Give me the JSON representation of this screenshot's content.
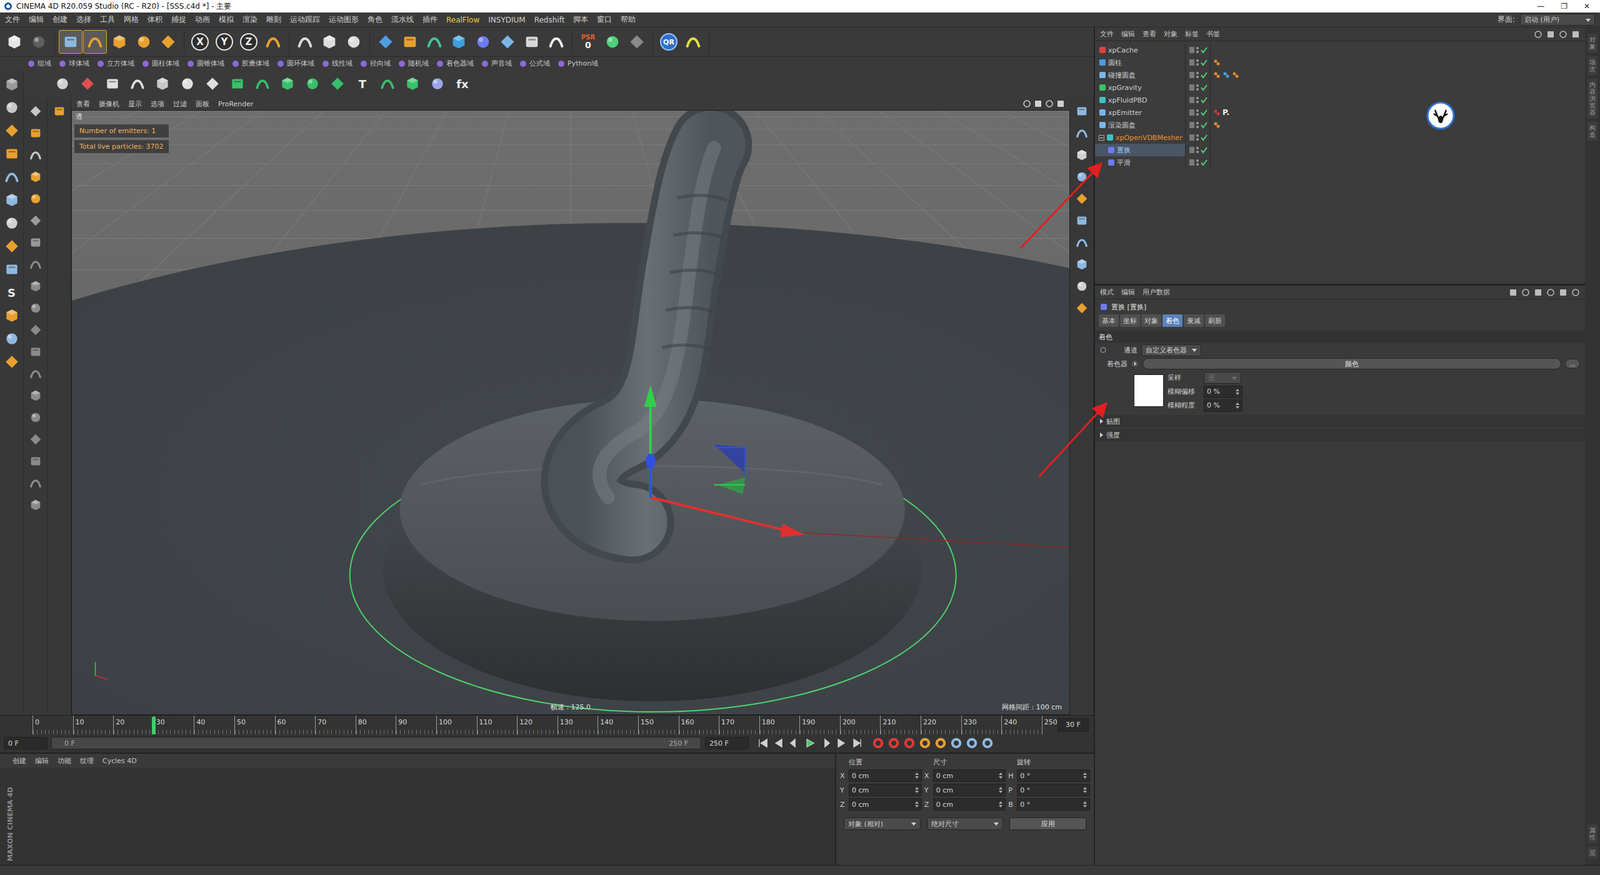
{
  "window": {
    "title": "CINEMA 4D R20.059 Studio (RC - R20) - [SSS.c4d *] - 主要",
    "controls": [
      "—",
      "❐",
      "✕"
    ]
  },
  "menu": {
    "items": [
      {
        "label": "文件",
        "highlight": false
      },
      {
        "label": "编辑",
        "highlight": false
      },
      {
        "label": "创建",
        "highlight": false
      },
      {
        "label": "选择",
        "highlight": false
      },
      {
        "label": "工具",
        "highlight": false
      },
      {
        "label": "网格",
        "highlight": false
      },
      {
        "label": "体积",
        "highlight": false
      },
      {
        "label": "捕捉",
        "highlight": false
      },
      {
        "label": "动画",
        "highlight": false
      },
      {
        "label": "模拟",
        "highlight": false
      },
      {
        "label": "渲染",
        "highlight": false
      },
      {
        "label": "雕刻",
        "highlight": false
      },
      {
        "label": "运动跟踪",
        "highlight": false
      },
      {
        "label": "运动图形",
        "highlight": false
      },
      {
        "label": "角色",
        "highlight": false
      },
      {
        "label": "流水线",
        "highlight": false
      },
      {
        "label": "插件",
        "highlight": false
      },
      {
        "label": "RealFlow",
        "highlight": true
      },
      {
        "label": "INSYDIUM",
        "highlight": false
      },
      {
        "label": "Redshift",
        "highlight": false
      },
      {
        "label": "脚本",
        "highlight": false
      },
      {
        "label": "窗口",
        "highlight": false
      },
      {
        "label": "帮助",
        "highlight": false
      }
    ],
    "layout_label": "界面:",
    "layout_value": "启动 (用户)"
  },
  "main_toolbar": [
    [
      {
        "kind": "icon",
        "color": "#e6e6e6",
        "selected": false
      },
      {
        "kind": "icon",
        "color": "#5e5e5e",
        "selected": false
      }
    ],
    [
      {
        "kind": "icon",
        "color": "#8fb8e0",
        "selected": true
      },
      {
        "kind": "icon",
        "color": "#e8a030",
        "selected": true
      },
      {
        "kind": "icon",
        "color": "#e8a030",
        "selected": false
      },
      {
        "kind": "icon",
        "color": "#e8a030",
        "selected": false
      },
      {
        "kind": "icon",
        "color": "#e8a030",
        "selected": false
      }
    ],
    [
      {
        "kind": "axis",
        "label": "X",
        "selected": false
      },
      {
        "kind": "axis",
        "label": "Y",
        "selected": false
      },
      {
        "kind": "axis",
        "label": "Z",
        "selected": false
      },
      {
        "kind": "icon",
        "color": "#e8a030",
        "selected": false
      }
    ],
    [
      {
        "kind": "icon",
        "color": "#dddddd",
        "selected": false
      },
      {
        "kind": "icon",
        "color": "#dddddd",
        "selected": false
      },
      {
        "kind": "icon",
        "color": "#dddddd",
        "selected": false
      }
    ],
    [
      {
        "kind": "icon",
        "color": "#4f9ee0",
        "selected": false
      },
      {
        "kind": "icon",
        "color": "#e8a030",
        "selected": false
      },
      {
        "kind": "icon",
        "color": "#3fc39a",
        "selected": false
      },
      {
        "kind": "icon",
        "color": "#3f9fe0",
        "selected": false
      },
      {
        "kind": "icon",
        "color": "#6b7cf0",
        "selected": false
      },
      {
        "kind": "icon",
        "color": "#7ab6ea",
        "selected": false
      },
      {
        "kind": "icon",
        "color": "#d8d8d8",
        "selected": false
      },
      {
        "kind": "icon",
        "color": "#f0f0f0",
        "selected": false
      }
    ],
    [
      {
        "kind": "badge",
        "label": "PSR",
        "sub": "0",
        "selected": false
      },
      {
        "kind": "icon",
        "color": "#4fd07a",
        "selected": false
      },
      {
        "kind": "icon",
        "color": "#8a8a8a",
        "selected": false
      }
    ],
    [
      {
        "kind": "round",
        "label": "QR",
        "selected": false
      },
      {
        "kind": "icon",
        "color": "#e0e040",
        "selected": false
      }
    ]
  ],
  "field_toolbar": [
    "组域",
    "球体域",
    "立方体域",
    "圆柱体域",
    "圆锥体域",
    "胶囊体域",
    "圆环体域",
    "线性域",
    "径向域",
    "随机域",
    "着色器域",
    "声音域",
    "公式域",
    "Python域"
  ],
  "create_toolbar": [
    {
      "kind": "icon",
      "color": "#d0d0d0"
    },
    {
      "kind": "icon",
      "color": "#e05050"
    },
    {
      "kind": "icon",
      "color": "#e0e0e0"
    },
    {
      "kind": "icon",
      "color": "#e0e0e0"
    },
    {
      "kind": "icon",
      "color": "#c8c8c8"
    },
    {
      "kind": "icon",
      "color": "#e0e0e0"
    },
    {
      "kind": "icon",
      "color": "#e0e0e0"
    },
    {
      "kind": "icon",
      "color": "#38c06a"
    },
    {
      "kind": "icon",
      "color": "#38c06a"
    },
    {
      "kind": "icon",
      "color": "#38c06a"
    },
    {
      "kind": "icon",
      "color": "#38c06a"
    },
    {
      "kind": "icon",
      "color": "#38c06a"
    },
    {
      "kind": "text",
      "label": "T"
    },
    {
      "kind": "icon",
      "color": "#38c06a"
    },
    {
      "kind": "icon",
      "color": "#38c06a"
    },
    {
      "kind": "icon",
      "color": "#9aa6e8"
    },
    {
      "kind": "text",
      "label": "fx"
    }
  ],
  "left_toolbar": [
    {
      "kind": "icon",
      "color": "#9a9a9a"
    },
    {
      "kind": "icon",
      "color": "#c8c8c8"
    },
    {
      "kind": "icon",
      "color": "#e8a030"
    },
    {
      "kind": "icon",
      "color": "#e8a030"
    },
    {
      "kind": "icon",
      "color": "#8fb8e0"
    },
    {
      "kind": "icon",
      "color": "#8fb8e0"
    },
    {
      "kind": "icon",
      "color": "#d0d0d0"
    },
    {
      "kind": "icon",
      "color": "#e8a030"
    },
    {
      "kind": "icon",
      "color": "#8fb8e0"
    },
    {
      "kind": "text",
      "label": "S"
    },
    {
      "kind": "icon",
      "color": "#e8a030"
    },
    {
      "kind": "icon",
      "color": "#8fb8e0"
    },
    {
      "kind": "icon",
      "color": "#e8a030"
    }
  ],
  "palette_a": [
    "#c8c8c8",
    "#e8a030",
    "#c8c8c8",
    "#e8a030",
    "#e8a030",
    "#9a9a9a",
    "#9a9a9a",
    "#8a8a8a",
    "#8a8a8a",
    "#8a8a8a",
    "#8a8a8a",
    "#8a8a8a",
    "#8a8a8a",
    "#8a8a8a",
    "#8a8a8a",
    "#8a8a8a",
    "#8a8a8a",
    "#8a8a8a",
    "#8a8a8a"
  ],
  "palette_b": [
    "#e8a030"
  ],
  "palette_right": [
    "#8fb8e0",
    "#8fb8e0",
    "#d0d0d0",
    "#8fb8e0",
    "#e8a030",
    "#8fb8e0",
    "#8fb8e0",
    "#8fb8e0",
    "#d0d0d0",
    "#e8a030"
  ],
  "viewport": {
    "menu": [
      "查看",
      "摄像机",
      "显示",
      "选项",
      "过滤",
      "面板",
      "ProRender"
    ],
    "name": "透",
    "overlay": [
      "Number of emitters: 1",
      "Total live particles: 3702"
    ],
    "fps": "帧速 : 125.0",
    "grid": "网格间距 : 100 cm"
  },
  "timeline": {
    "ticks": [
      "0",
      "10",
      "20",
      "30",
      "40",
      "50",
      "60",
      "70",
      "80",
      "90",
      "100",
      "110",
      "120",
      "130",
      "140",
      "150",
      "160",
      "170",
      "180",
      "190",
      "200",
      "210",
      "220",
      "230",
      "240",
      "250"
    ],
    "level": 0.12,
    "frame_box": "30 F",
    "start": "0 F",
    "range_start": "0 F",
    "range_end": "250 F",
    "end": "250 F"
  },
  "material_manager": {
    "menu": [
      "创建",
      "编辑",
      "功能",
      "纹理",
      "Cycles 4D"
    ]
  },
  "coordinates": {
    "columns": [
      {
        "header": "位置",
        "rows": [
          {
            "axis": "X",
            "value": "0 cm"
          },
          {
            "axis": "Y",
            "value": "0 cm"
          },
          {
            "axis": "Z",
            "value": "0 cm"
          }
        ]
      },
      {
        "header": "尺寸",
        "rows": [
          {
            "axis": "X",
            "value": "0 cm"
          },
          {
            "axis": "Y",
            "value": "0 cm"
          },
          {
            "axis": "Z",
            "value": "0 cm"
          }
        ]
      },
      {
        "header": "旋转",
        "rows": [
          {
            "axis": "H",
            "value": "0 °"
          },
          {
            "axis": "P",
            "value": "0 °"
          },
          {
            "axis": "B",
            "value": "0 °"
          }
        ]
      }
    ],
    "mode": "对象 (相对)",
    "size_mode": "绝对尺寸",
    "apply": "应用"
  },
  "object_manager": {
    "menu": [
      "文件",
      "编辑",
      "查看",
      "对象",
      "标签",
      "书签"
    ],
    "objects": [
      {
        "name": "xpCache",
        "depth": 0,
        "color": "#e04040",
        "selected": false,
        "highlighted": false,
        "expanded": false,
        "tags": []
      },
      {
        "name": "圆柱",
        "depth": 0,
        "color": "#4f9ee0",
        "selected": false,
        "highlighted": false,
        "expanded": false,
        "tags": [
          {
            "kind": "icon",
            "color": "#e08a30"
          }
        ]
      },
      {
        "name": "碰撞圆盘",
        "depth": 0,
        "color": "#7ab6ea",
        "selected": false,
        "highlighted": false,
        "expanded": false,
        "tags": [
          {
            "kind": "icon",
            "color": "#e08a30"
          },
          {
            "kind": "icon",
            "color": "#4f9ee0"
          },
          {
            "kind": "icon",
            "color": "#e08a30"
          }
        ]
      },
      {
        "name": "xpGravity",
        "depth": 0,
        "color": "#3fc06a",
        "selected": false,
        "highlighted": false,
        "expanded": false,
        "tags": []
      },
      {
        "name": "xpFluidPBD",
        "depth": 0,
        "color": "#3fc0c0",
        "selected": false,
        "highlighted": false,
        "expanded": false,
        "tags": []
      },
      {
        "name": "xpEmitter",
        "depth": 0,
        "color": "#7ab6ea",
        "selected": false,
        "highlighted": false,
        "expanded": false,
        "tags": [
          {
            "kind": "icon",
            "color": "#d83030"
          },
          {
            "kind": "text",
            "label": "P."
          }
        ]
      },
      {
        "name": "渲染圆盘",
        "depth": 0,
        "color": "#7ab6ea",
        "selected": false,
        "highlighted": false,
        "expanded": false,
        "tags": [
          {
            "kind": "icon",
            "color": "#e08a30"
          }
        ]
      },
      {
        "name": "xpOpenVDBMesher",
        "depth": 0,
        "color": "#3fc0c0",
        "selected": false,
        "highlighted": true,
        "expanded": true,
        "tags": []
      },
      {
        "name": "置换",
        "depth": 1,
        "color": "#6b7cf0",
        "selected": true,
        "highlighted": false,
        "expanded": false,
        "tags": []
      },
      {
        "name": "平滑",
        "depth": 1,
        "color": "#6b7cf0",
        "selected": false,
        "highlighted": false,
        "expanded": false,
        "tags": []
      }
    ]
  },
  "attribute_manager": {
    "menu": [
      "模式",
      "编辑",
      "用户数据"
    ],
    "title": "置换 [置换]",
    "tabs": [
      {
        "label": "基本",
        "selected": false
      },
      {
        "label": "坐标",
        "selected": false
      },
      {
        "label": "对象",
        "selected": false
      },
      {
        "label": "着色",
        "selected": true
      },
      {
        "label": "衰减",
        "selected": false
      },
      {
        "label": "刷新",
        "selected": false
      }
    ],
    "section": "着色",
    "channel": {
      "label": "通道",
      "value": "自定义着色器"
    },
    "shader": {
      "label": "着色器",
      "value": "颜色",
      "more": "..."
    },
    "params": [
      {
        "label": "采样",
        "value": "无",
        "kind": "select",
        "disabled": true
      },
      {
        "label": "模糊偏移",
        "value": "0 %",
        "kind": "spin",
        "disabled": false
      },
      {
        "label": "模糊程度",
        "value": "0 %",
        "kind": "spin",
        "disabled": false
      }
    ],
    "groups": [
      {
        "label": "贴图",
        "expanded": false
      },
      {
        "label": "强度",
        "expanded": false
      }
    ]
  },
  "side_tabs": {
    "top": [
      "对象",
      "场次",
      "内容浏览器",
      "构造"
    ],
    "bottom": [
      "属性",
      "层"
    ]
  },
  "logo": "MAXON CINEMA 4D"
}
